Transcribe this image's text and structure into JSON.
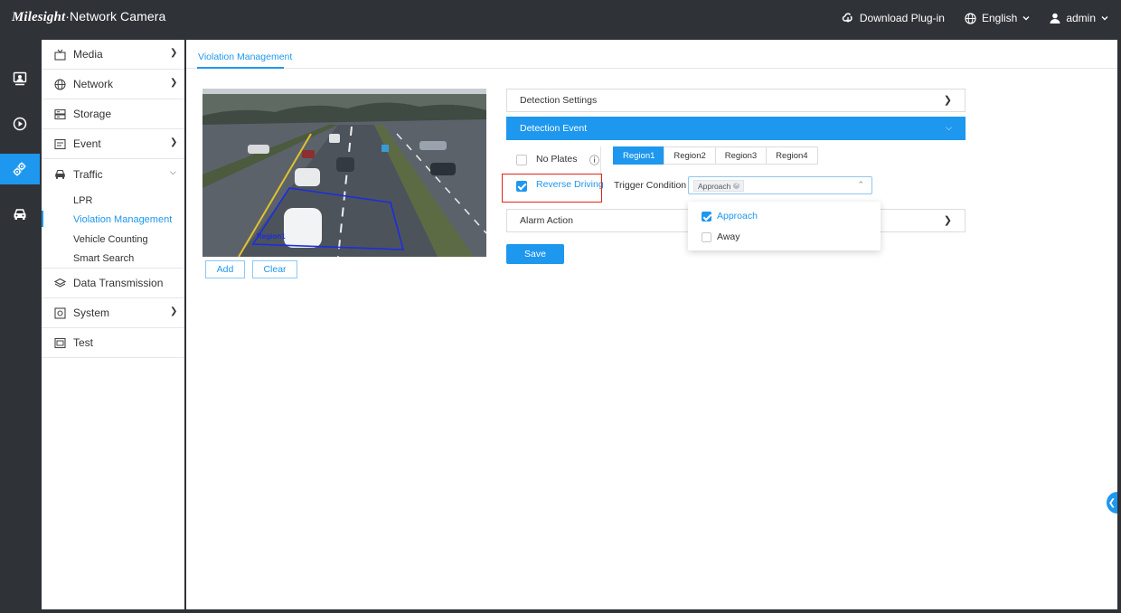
{
  "app": {
    "logo_text": "Milesight",
    "title": "Network Camera"
  },
  "topbar": {
    "download_label": "Download Plug-in",
    "language_label": "English",
    "user_label": "admin"
  },
  "rail": [
    "live-view-icon",
    "playback-icon",
    "settings-icon",
    "traffic-icon"
  ],
  "nav": {
    "items": [
      {
        "label": "Media",
        "icon": "media-icon",
        "has_arrow": true
      },
      {
        "label": "Network",
        "icon": "globe-icon",
        "has_arrow": true
      },
      {
        "label": "Storage",
        "icon": "storage-icon",
        "has_arrow": false
      },
      {
        "label": "Event",
        "icon": "event-icon",
        "has_arrow": true
      },
      {
        "label": "Traffic",
        "icon": "car-icon",
        "has_arrow": true,
        "expanded": true
      },
      {
        "label": "Data Transmission",
        "icon": "layers-icon",
        "has_arrow": false
      },
      {
        "label": "System",
        "icon": "system-icon",
        "has_arrow": true
      },
      {
        "label": "Test",
        "icon": "test-icon",
        "has_arrow": false
      }
    ],
    "traffic_sub": [
      "LPR",
      "Violation Management",
      "Vehicle Counting",
      "Smart Search"
    ],
    "active_sub": "Violation Management"
  },
  "main": {
    "tab": "Violation Management",
    "video": {
      "region_label": "Region1"
    },
    "add_label": "Add",
    "clear_label": "Clear",
    "accordions": {
      "detection_settings": "Detection Settings",
      "detection_event": "Detection Event",
      "alarm_action": "Alarm Action"
    },
    "no_plates_label": "No Plates",
    "reverse_driving_label": "Reverse Driving",
    "regions": [
      "Region1",
      "Region2",
      "Region3",
      "Region4"
    ],
    "trigger_condition_label": "Trigger Condition",
    "selected_tag": "Approach",
    "options": [
      {
        "label": "Approach",
        "checked": true
      },
      {
        "label": "Away",
        "checked": false
      }
    ],
    "save_label": "Save"
  },
  "colors": {
    "accent": "#1e97ee",
    "topbar": "#2f3237",
    "highlight": "#e2231a"
  }
}
